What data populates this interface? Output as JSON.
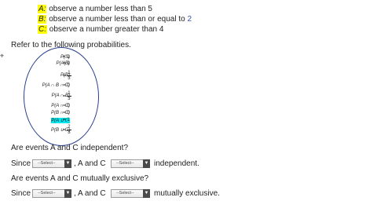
{
  "events": [
    {
      "letter": "A",
      "colon": ":",
      "text": " observe a number less than 5",
      "number": ""
    },
    {
      "letter": "B",
      "colon": ":",
      "text": " observe a number less than or equal to ",
      "number": "2"
    },
    {
      "letter": "C",
      "colon": ":",
      "text": " observe a number greater than 4",
      "number": ""
    }
  ],
  "refer_text": "Refer to the following probabilities.",
  "cursor_glyph": "⌖",
  "probabilities": [
    {
      "lhs": "P(S)",
      "eq": "=",
      "value": "1"
    },
    {
      "lhs": "P(A|B)",
      "eq": "=",
      "value": "1"
    },
    {
      "lhs": "P(B)",
      "eq": "=",
      "num": "1",
      "den": "3"
    },
    {
      "lhs": "P(A ∩ B ∩ C)",
      "eq": "=",
      "value": "0"
    },
    {
      "lhs": "P(A ∩ B)",
      "eq": "=",
      "num": "1",
      "den": "3"
    },
    {
      "lhs": "P(A ∩ C)",
      "eq": "=",
      "value": "0"
    },
    {
      "lhs": "P(B ∩ C)",
      "eq": "=",
      "value": "0"
    },
    {
      "lhs": "P(A ∪ C)",
      "eq": "=",
      "value": "1"
    },
    {
      "lhs": "P(B ∪ C)",
      "eq": "=",
      "num": "2",
      "den": "3"
    }
  ],
  "q1": {
    "question": "Are events A and C independent?",
    "since": "Since",
    "comma_mid": ", A and C",
    "end": "independent."
  },
  "q2": {
    "question": "Are events A and C mutually exclusive?",
    "since": "Since",
    "comma_mid": ", A and C",
    "end": "mutually exclusive."
  },
  "select_placeholder": "--Select--",
  "select_arrow": "▼",
  "colors": {
    "highlight": "#ffff00",
    "cyan_highlight": "#00e5ee",
    "ellipse": "#2a3f8f",
    "number_blue": "#3355bb"
  }
}
